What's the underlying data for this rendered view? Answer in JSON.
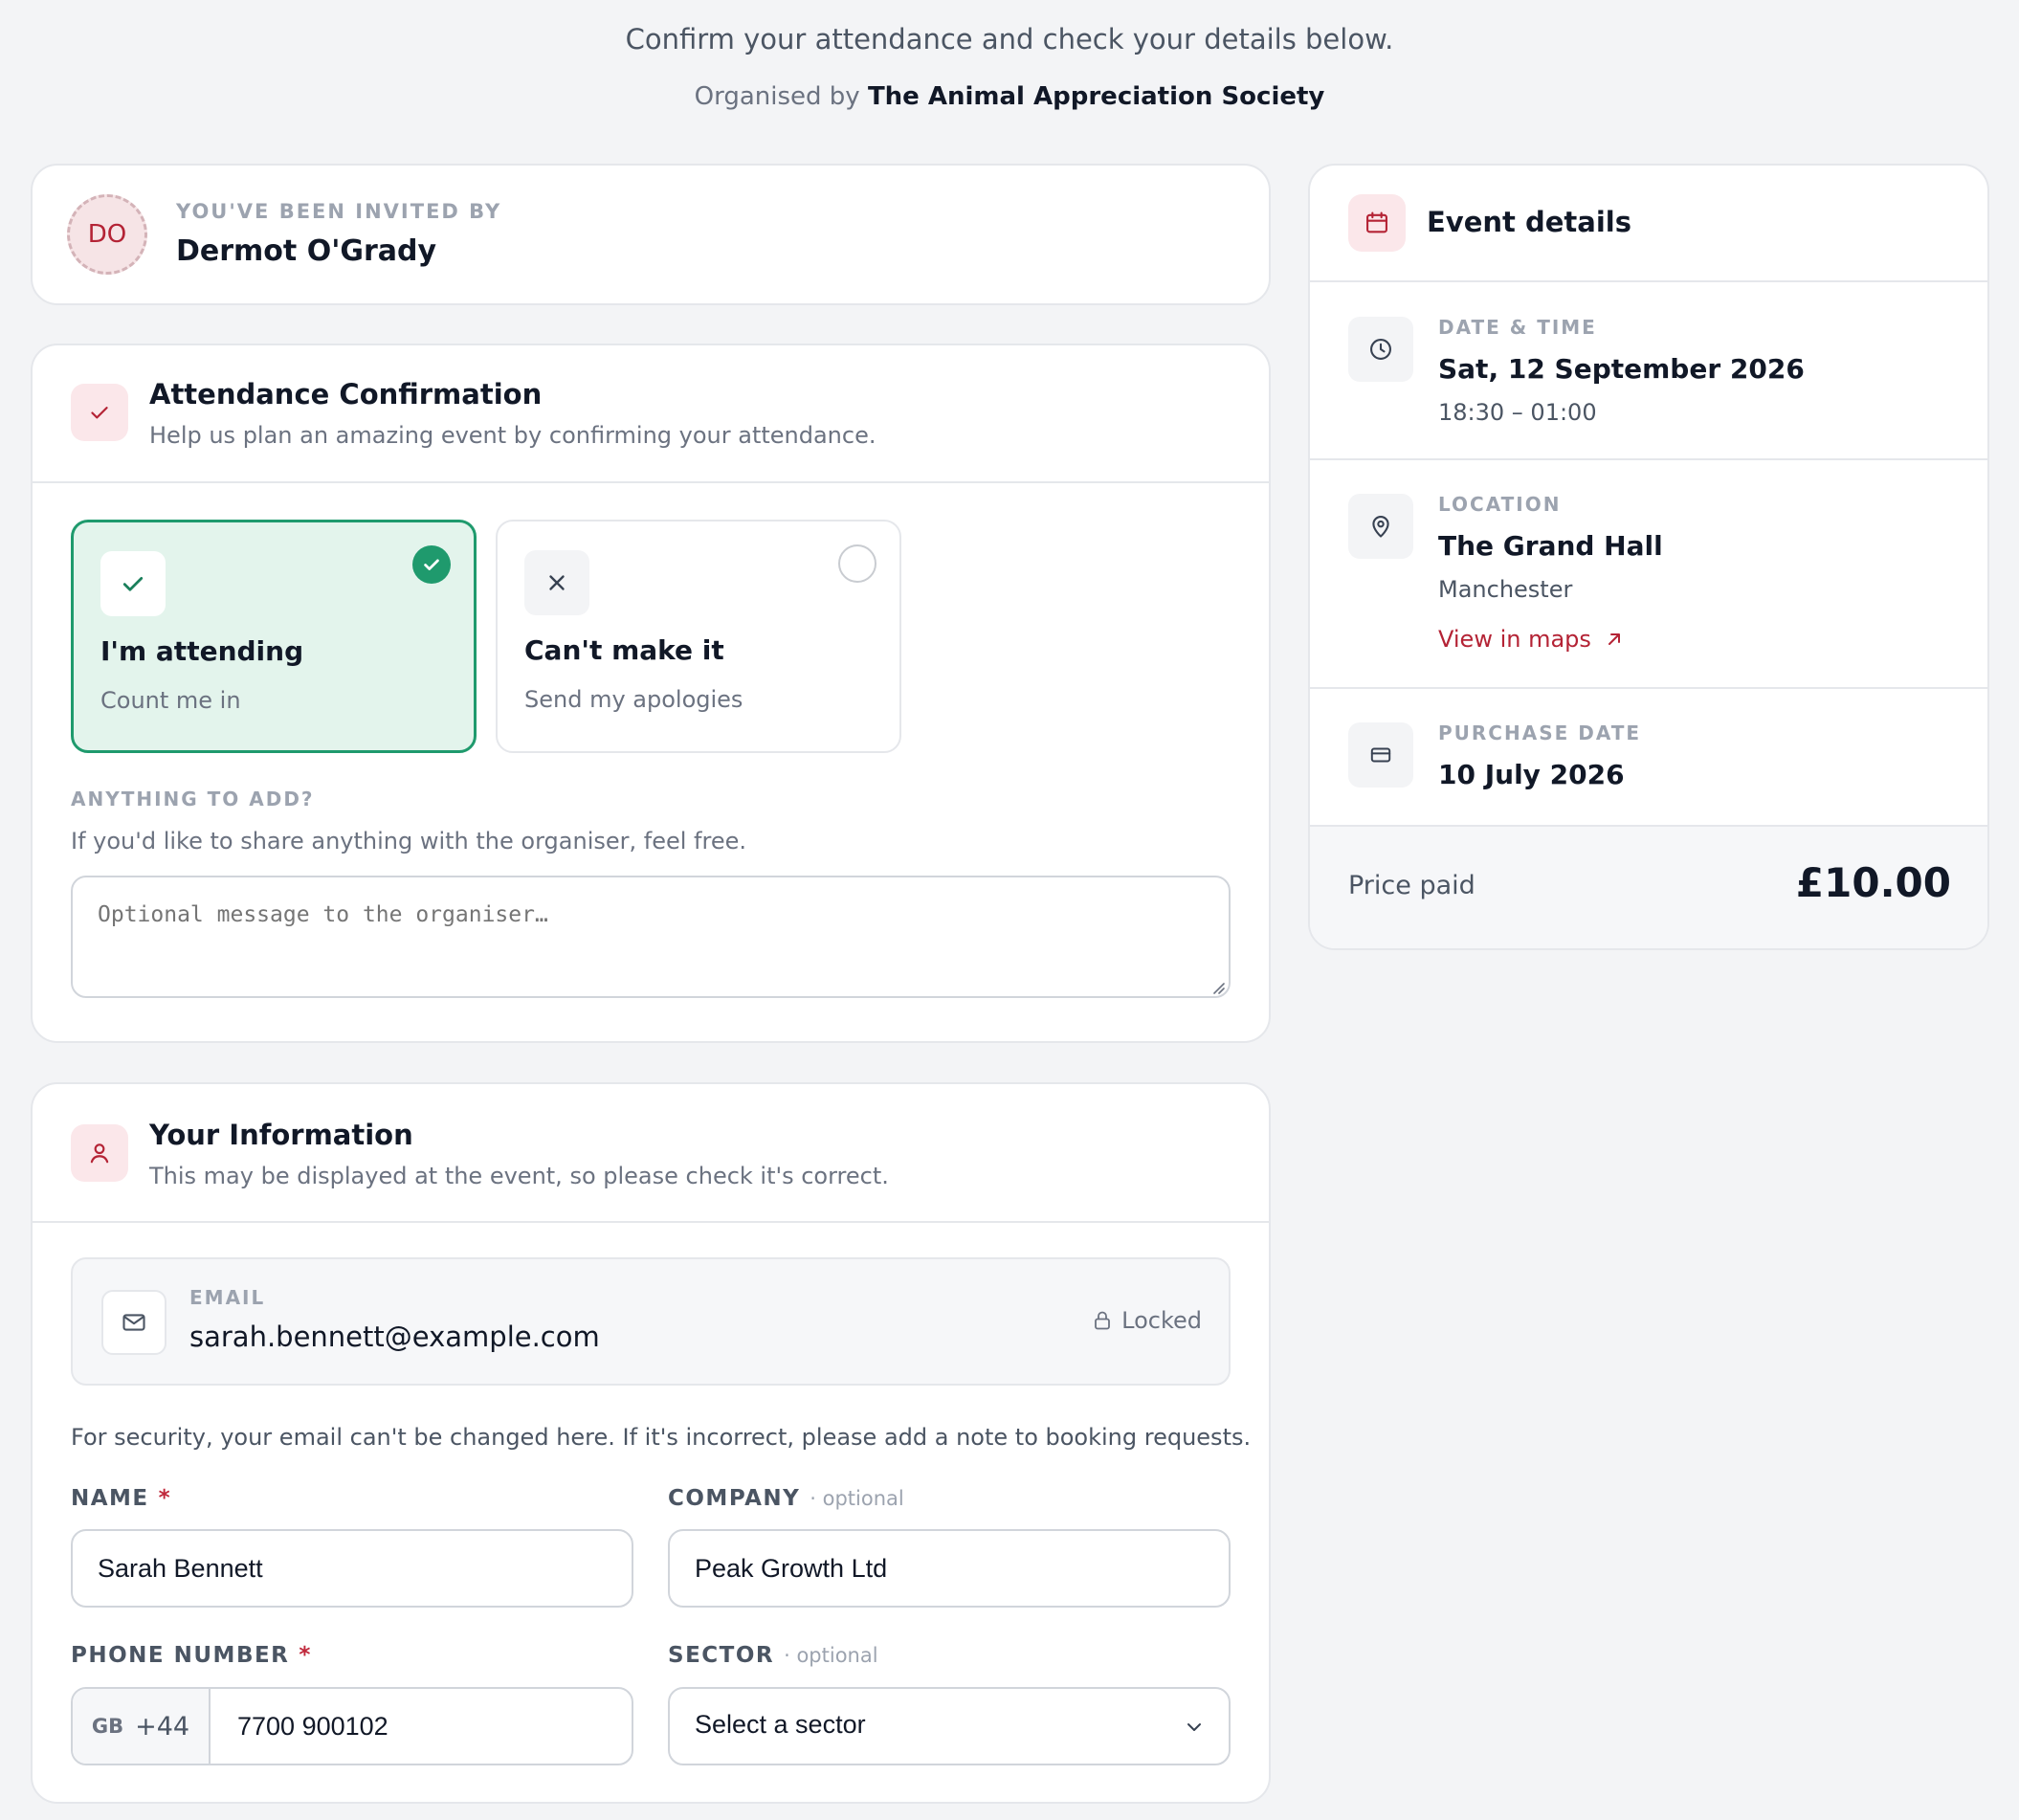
{
  "header": {
    "subtitle": "Confirm your attendance and check your details below.",
    "organised_prefix": "Organised by",
    "organiser": "The Animal Appreciation Society"
  },
  "invite": {
    "label": "YOU'VE BEEN INVITED BY",
    "initials": "DO",
    "name": "Dermot O'Grady"
  },
  "attendance": {
    "title": "Attendance Confirmation",
    "description": "Help us plan an amazing event by confirming your attendance.",
    "options": [
      {
        "title": "I'm attending",
        "subtitle": "Count me in",
        "selected": true,
        "icon": "check-icon"
      },
      {
        "title": "Can't make it",
        "subtitle": "Send my apologies",
        "selected": false,
        "icon": "x-icon"
      }
    ],
    "add_label": "ANYTHING TO ADD?",
    "add_hint": "If you'd like to share anything with the organiser, feel free.",
    "message_placeholder": "Optional message to the organiser…",
    "message_value": ""
  },
  "info": {
    "title": "Your Information",
    "description": "This may be displayed at the event, so please check it's correct.",
    "email_label": "EMAIL",
    "email_value": "sarah.bennett@example.com",
    "locked_label": "Locked",
    "security_note": "For security, your email can't be changed here. If it's incorrect, please add a note to booking requests.",
    "name_label": "NAME",
    "name_value": "Sarah Bennett",
    "company_label": "COMPANY",
    "company_optional": "· optional",
    "company_value": "Peak Growth Ltd",
    "phone_label": "PHONE NUMBER",
    "phone_country": "GB",
    "phone_dial": "+44",
    "phone_value": "7700 900102",
    "sector_label": "SECTOR",
    "sector_optional": "· optional",
    "sector_value": "Select a sector",
    "required_mark": "*"
  },
  "event": {
    "title": "Event details",
    "date_label": "DATE & TIME",
    "date_value": "Sat, 12 September 2026",
    "time_value": "18:30 – 01:00",
    "location_label": "LOCATION",
    "location_value": "The Grand Hall",
    "location_city": "Manchester",
    "maps_link": "View in maps",
    "purchase_label": "PURCHASE DATE",
    "purchase_value": "10 July 2026",
    "price_label": "Price paid",
    "price_value": "£10.00"
  },
  "colors": {
    "accent": "#b42335",
    "success": "#1f9a6d",
    "success_bg": "#e3f4ec",
    "accent_bg": "#fbe7ea",
    "page_bg": "#f3f4f6"
  }
}
